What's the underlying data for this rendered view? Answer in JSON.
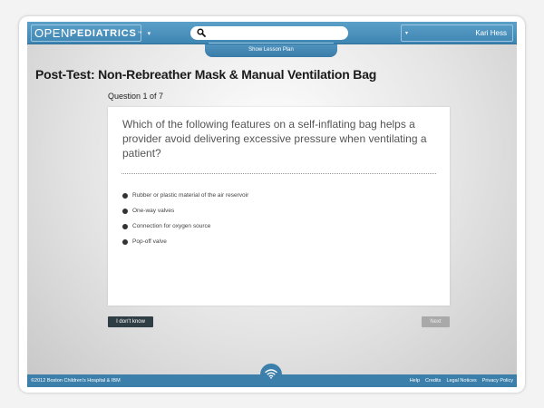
{
  "header": {
    "logo_open": "OPEN",
    "logo_pediatrics": "PEDIATRICS",
    "logo_tm": "™",
    "logo_caret": "▾",
    "search_placeholder": "",
    "user_name": "Kari Hess",
    "user_caret": "▾",
    "lesson_plan_label": "Show Lesson Plan"
  },
  "page": {
    "title": "Post-Test: Non-Rebreather Mask & Manual Ventilation Bag",
    "question_counter": "Question 1 of 7"
  },
  "question": {
    "text": "Which of the following features on a self-inflating bag helps a provider avoid delivering excessive pressure when ventilating a patient?",
    "options": [
      "Rubber or plastic material of the air reservoir",
      "One-way valves",
      "Connection for oxygen source",
      "Pop-off valve"
    ]
  },
  "buttons": {
    "dont_know": "I don't know",
    "next": "Next"
  },
  "footer": {
    "copyright": "©2012 Boston Children's Hospital & IBM",
    "links": [
      "Help",
      "Credits",
      "Legal Notices",
      "Privacy Policy"
    ]
  },
  "icons": {
    "search": "search-icon",
    "wifi": "wifi-icon"
  },
  "colors": {
    "header_blue": "#4a90bd",
    "footer_blue": "#3c7fab",
    "dark_button": "#2f3d45",
    "disabled_button": "#a9a9a9"
  }
}
